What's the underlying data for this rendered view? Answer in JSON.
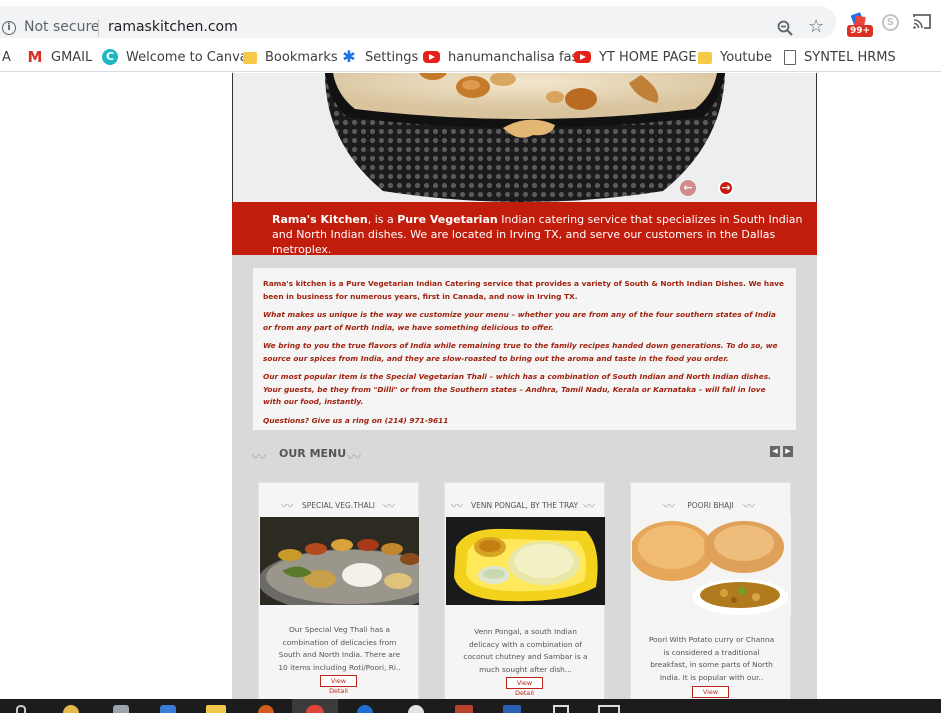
{
  "browser": {
    "security_label": "Not secure",
    "url": "ramaskitchen.com",
    "extension_badge": "99+",
    "bookmarks": [
      {
        "label": "A",
        "icon": "none"
      },
      {
        "label": "GMAIL",
        "icon": "gmail-icon"
      },
      {
        "label": "Welcome to Canva",
        "icon": "canva-icon"
      },
      {
        "label": "Bookmarks",
        "icon": "folder-icon"
      },
      {
        "label": "Settings",
        "icon": "gear-icon"
      },
      {
        "label": "hanumanchalisa fast",
        "icon": "youtube-icon"
      },
      {
        "label": "YT HOME PAGE",
        "icon": "youtube-icon"
      },
      {
        "label": "Youtube",
        "icon": "folder-icon"
      },
      {
        "label": "SYNTEL HRMS",
        "icon": "page-icon"
      }
    ]
  },
  "banner": {
    "brand": "Rama's Kitchen",
    "middle": ", is a",
    "highlight": "Pure Vegetarian",
    "rest": " Indian catering service that specializes in South Indian and North Indian dishes. We are located in Irving TX, and serve our customers in the Dallas metroplex."
  },
  "about": {
    "p1": "Rama's kitchen is a Pure Vegetarian Indian Catering service that provides a variety of South & North Indian Dishes. We have been in business for numerous years, first in Canada, and now in Irving TX.",
    "p2": "What makes us unique is the way we customize your menu – whether you are from any of the four southern states of India or from any part of North India, we have something delicious to offer.",
    "p3": "We bring to you the true flavors of India while remaining true to the family recipes handed down generations. To do so, we source our spices from India, and they are slow-roasted to bring out the aroma and taste in the food you order.",
    "p4": "Our most popular item is the Special Vegetarian Thali – which has a combination of South Indian and North Indian dishes. Your guests, be they from \"Dilli\" or from the Southern states – Andhra, Tamil Nadu, Kerala or Karnataka – will fall in love with our food, instantly.",
    "p5": "Questions? Give us a ring on (214) 971-9611"
  },
  "menu": {
    "title": "OUR MENU",
    "items": [
      {
        "title": "SPECIAL VEG.THALI",
        "desc": "Our Special Veg Thali has a combination of delicacies from South and North India. There are 10 items including Roti/Poori, Ri..",
        "button": "View Detail"
      },
      {
        "title": "VENN PONGAL, BY THE TRAY",
        "desc": "Venn Pongal, a south Indian delicacy with a combination of coconut chutney and Sambar is a much sought after dish...",
        "button": "View Detail"
      },
      {
        "title": "POORI BHAJI",
        "desc": "Poori With Potato curry or Channa is considered a traditional breakfast, in some parts of North India. It is popular with our..",
        "button": "View Detail"
      }
    ]
  },
  "colors": {
    "brand_red": "#c21c0c",
    "about_text": "#a1230f"
  }
}
